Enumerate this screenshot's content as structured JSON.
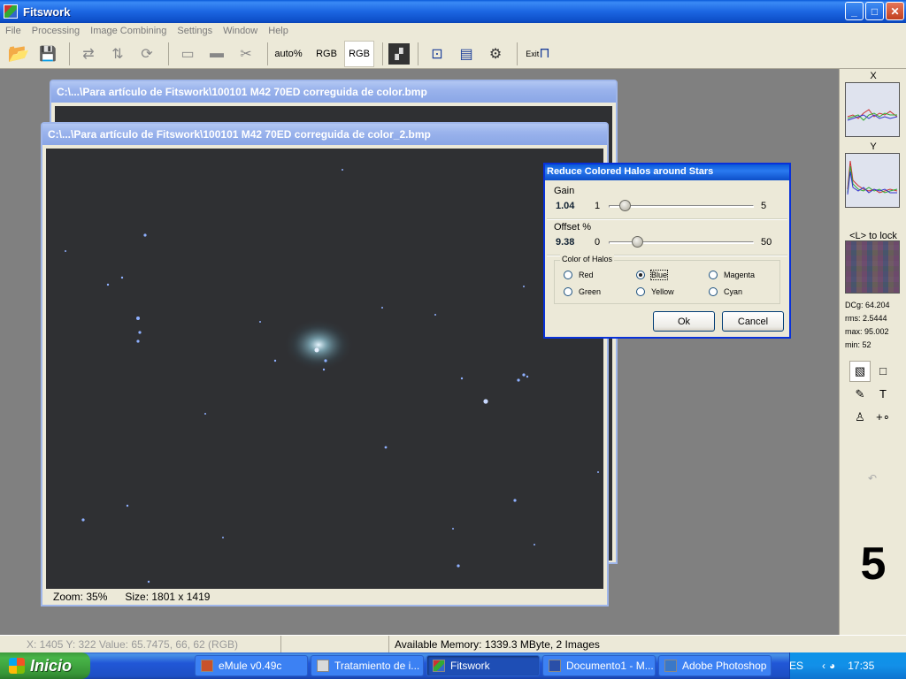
{
  "app": {
    "title": "Fitswork"
  },
  "window_buttons": {
    "minimize": "_",
    "maximize": "□",
    "close": "✕"
  },
  "menu": [
    "File",
    "Processing",
    "Image Combining",
    "Settings",
    "Window",
    "Help"
  ],
  "toolbar": {
    "auto_label_1": "auto",
    "auto_label_2": "%",
    "rgb1": "RGB",
    "rgb2": "RGB",
    "exit": "Exit"
  },
  "windows": [
    {
      "title": "C:\\...\\Para artículo de Fitswork\\100101 M42 70ED correguida de color.bmp"
    },
    {
      "title": "C:\\...\\Para artículo de Fitswork\\100101 M42 70ED correguida de color_2.bmp",
      "zoom": "Zoom: 35%",
      "size": "Size: 1801 x 1419"
    }
  ],
  "dialog": {
    "title": "Reduce Colored Halos around Stars",
    "gain": {
      "label": "Gain",
      "value": "1.04",
      "min": "1",
      "max": "5",
      "level": 0.01
    },
    "offset": {
      "label": "Offset %",
      "value": "9.38",
      "min": "0",
      "max": "50",
      "level": 0.19
    },
    "group_title": "Color of Halos",
    "colors": [
      "Red",
      "Blue",
      "Magenta",
      "Green",
      "Yellow",
      "Cyan"
    ],
    "selected": "Blue",
    "ok": "Ok",
    "cancel": "Cancel"
  },
  "right_panel": {
    "x_label": "X",
    "y_label": "Y",
    "lock_label": "<L> to lock",
    "dcg": "DCg: 64.204",
    "rms": "rms: 2.5444",
    "max": "max: 95.002",
    "min": "min: 52",
    "big_number": "5"
  },
  "statusbar": {
    "coords": "X: 1405  Y: 322  Value: 65.7475, 66, 62 (RGB)",
    "memory": "Available Memory: 1339.3 MByte, 2 Images"
  },
  "taskbar": {
    "start": "Inicio",
    "tasks": [
      "eMule v0.49c",
      "Tratamiento de i...",
      "Fitswork",
      "Documento1 - M...",
      "Adobe Photoshop"
    ],
    "language": "ES",
    "clock": "17:35"
  }
}
